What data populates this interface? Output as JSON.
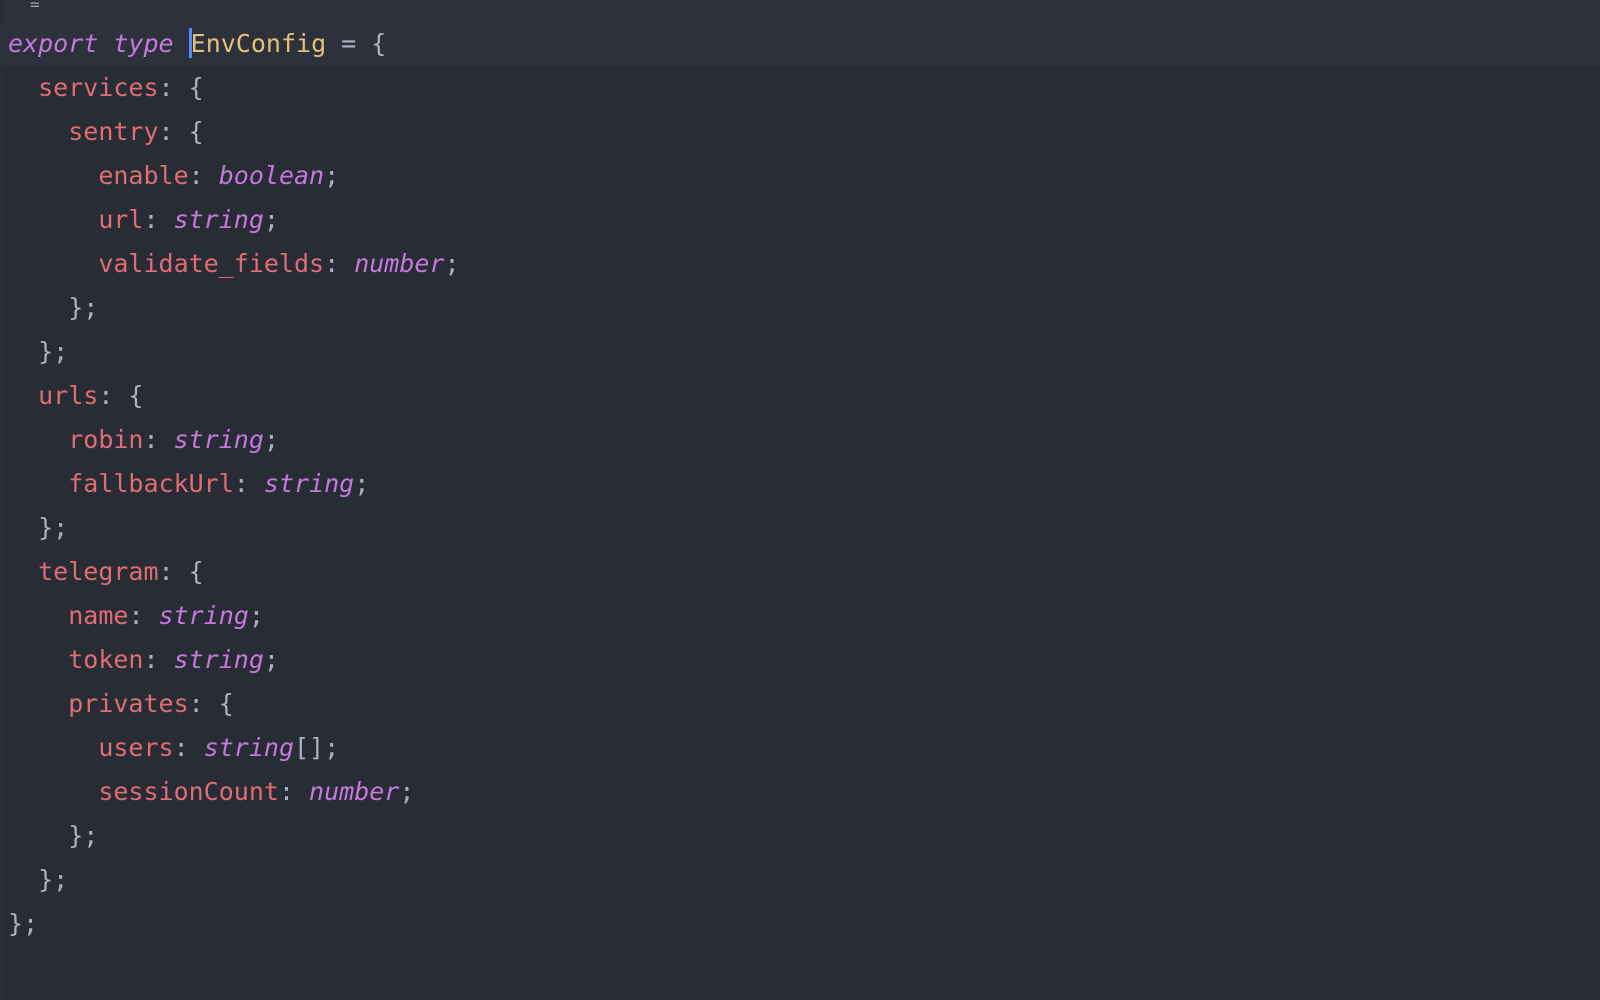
{
  "fold_marker": "=",
  "code": [
    {
      "indent": "",
      "tokens": [
        {
          "t": "export",
          "c": "kw"
        },
        {
          "t": " ",
          "c": "punc"
        },
        {
          "t": "type",
          "c": "kw"
        },
        {
          "t": " ",
          "c": "punc"
        },
        {
          "t": "CARET",
          "c": "caret"
        },
        {
          "t": "EnvConfig",
          "c": "tn"
        },
        {
          "t": " = {",
          "c": "punc"
        }
      ],
      "current": true
    },
    {
      "indent": "  ",
      "tokens": [
        {
          "t": "services",
          "c": "prop"
        },
        {
          "t": ": {",
          "c": "punc"
        }
      ]
    },
    {
      "indent": "    ",
      "tokens": [
        {
          "t": "sentry",
          "c": "prop"
        },
        {
          "t": ": {",
          "c": "punc"
        }
      ]
    },
    {
      "indent": "      ",
      "tokens": [
        {
          "t": "enable",
          "c": "prop"
        },
        {
          "t": ": ",
          "c": "punc"
        },
        {
          "t": "boolean",
          "c": "typ"
        },
        {
          "t": ";",
          "c": "punc"
        }
      ]
    },
    {
      "indent": "      ",
      "tokens": [
        {
          "t": "url",
          "c": "prop"
        },
        {
          "t": ": ",
          "c": "punc"
        },
        {
          "t": "string",
          "c": "typ"
        },
        {
          "t": ";",
          "c": "punc"
        }
      ]
    },
    {
      "indent": "      ",
      "tokens": [
        {
          "t": "validate_fields",
          "c": "prop"
        },
        {
          "t": ": ",
          "c": "punc"
        },
        {
          "t": "number",
          "c": "typ"
        },
        {
          "t": ";",
          "c": "punc"
        }
      ]
    },
    {
      "indent": "    ",
      "tokens": [
        {
          "t": "};",
          "c": "punc"
        }
      ]
    },
    {
      "indent": "  ",
      "tokens": [
        {
          "t": "};",
          "c": "punc"
        }
      ]
    },
    {
      "indent": "  ",
      "tokens": [
        {
          "t": "urls",
          "c": "prop"
        },
        {
          "t": ": {",
          "c": "punc"
        }
      ]
    },
    {
      "indent": "    ",
      "tokens": [
        {
          "t": "robin",
          "c": "prop"
        },
        {
          "t": ": ",
          "c": "punc"
        },
        {
          "t": "string",
          "c": "typ"
        },
        {
          "t": ";",
          "c": "punc"
        }
      ]
    },
    {
      "indent": "    ",
      "tokens": [
        {
          "t": "fallbackUrl",
          "c": "prop"
        },
        {
          "t": ": ",
          "c": "punc"
        },
        {
          "t": "string",
          "c": "typ"
        },
        {
          "t": ";",
          "c": "punc"
        }
      ]
    },
    {
      "indent": "  ",
      "tokens": [
        {
          "t": "};",
          "c": "punc"
        }
      ]
    },
    {
      "indent": "  ",
      "tokens": [
        {
          "t": "telegram",
          "c": "prop"
        },
        {
          "t": ": {",
          "c": "punc"
        }
      ]
    },
    {
      "indent": "    ",
      "tokens": [
        {
          "t": "name",
          "c": "prop"
        },
        {
          "t": ": ",
          "c": "punc"
        },
        {
          "t": "string",
          "c": "typ"
        },
        {
          "t": ";",
          "c": "punc"
        }
      ]
    },
    {
      "indent": "    ",
      "tokens": [
        {
          "t": "token",
          "c": "prop"
        },
        {
          "t": ": ",
          "c": "punc"
        },
        {
          "t": "string",
          "c": "typ"
        },
        {
          "t": ";",
          "c": "punc"
        }
      ]
    },
    {
      "indent": "    ",
      "tokens": [
        {
          "t": "privates",
          "c": "prop"
        },
        {
          "t": ": {",
          "c": "punc"
        }
      ]
    },
    {
      "indent": "      ",
      "tokens": [
        {
          "t": "users",
          "c": "prop"
        },
        {
          "t": ": ",
          "c": "punc"
        },
        {
          "t": "string",
          "c": "typ"
        },
        {
          "t": "[];",
          "c": "punc"
        }
      ]
    },
    {
      "indent": "      ",
      "tokens": [
        {
          "t": "sessionCount",
          "c": "prop"
        },
        {
          "t": ": ",
          "c": "punc"
        },
        {
          "t": "number",
          "c": "typ"
        },
        {
          "t": ";",
          "c": "punc"
        }
      ]
    },
    {
      "indent": "    ",
      "tokens": [
        {
          "t": "};",
          "c": "punc"
        }
      ]
    },
    {
      "indent": "  ",
      "tokens": [
        {
          "t": "};",
          "c": "punc"
        }
      ]
    },
    {
      "indent": "",
      "tokens": [
        {
          "t": "};",
          "c": "punc"
        }
      ]
    }
  ],
  "colors": {
    "background": "#282c34",
    "keyword": "#c678dd",
    "type_name": "#e5c07b",
    "property": "#e06c75",
    "punctuation": "#abb2bf",
    "caret": "#528bff"
  }
}
